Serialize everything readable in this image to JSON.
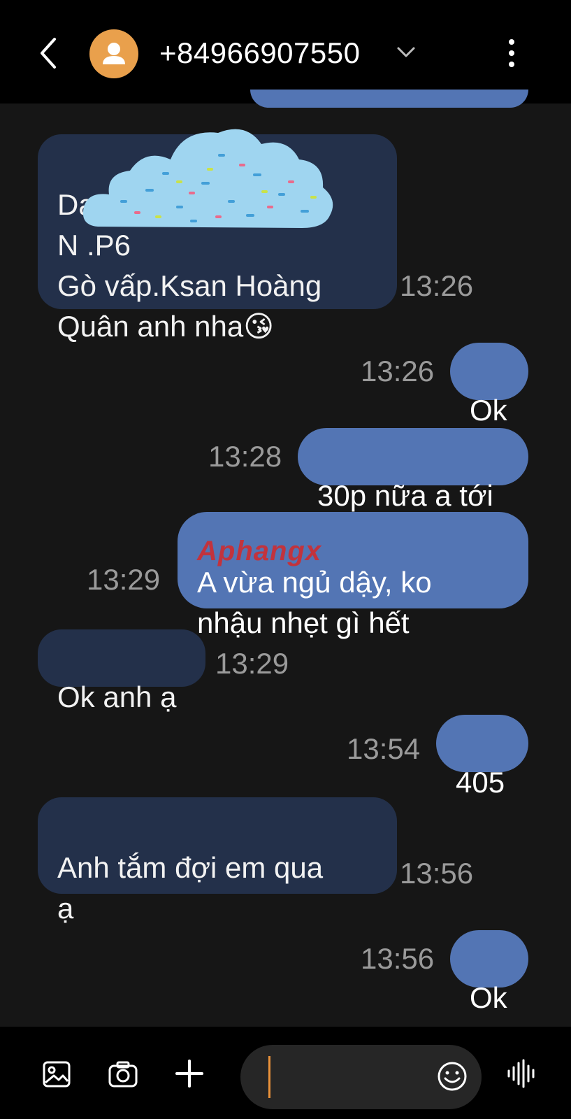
{
  "header": {
    "contact": "+84966907550",
    "icons": {
      "back": "chevron-left-icon",
      "avatar": "person-icon",
      "expand": "chevron-down-icon",
      "more": "more-vertical-icon"
    }
  },
  "messages": [
    {
      "dir": "in",
      "text": "Da.Anh                 /2\nN                          .P6\nGò vấp.Ksan Hoàng\nQuân anh nha😘",
      "time": "13:26"
    },
    {
      "dir": "out",
      "text": "Ok",
      "time": "13:26"
    },
    {
      "dir": "out",
      "text": "30p nữa a tới",
      "time": "13:28"
    },
    {
      "dir": "out",
      "text": "A vừa ngủ dậy, ko\nnhậu nhẹt gì hết",
      "time": "13:29"
    },
    {
      "dir": "in",
      "text": "Ok anh ạ",
      "time": "13:29"
    },
    {
      "dir": "out",
      "text": "405",
      "time": "13:54"
    },
    {
      "dir": "in",
      "text": "Anh tắm đợi em qua\nạ",
      "time": "13:56"
    },
    {
      "dir": "out",
      "text": "Ok",
      "time": "13:56"
    }
  ],
  "overlays": {
    "watermark": "Aphangx"
  },
  "composer": {
    "icons": [
      "image-icon",
      "camera-icon",
      "plus-icon",
      "emoji-icon",
      "voice-wave-icon"
    ]
  },
  "colors": {
    "incoming_bubble": "#23304a",
    "outgoing_bubble": "#5375b4",
    "avatar": "#e9a04c",
    "caret": "#e8913a"
  }
}
